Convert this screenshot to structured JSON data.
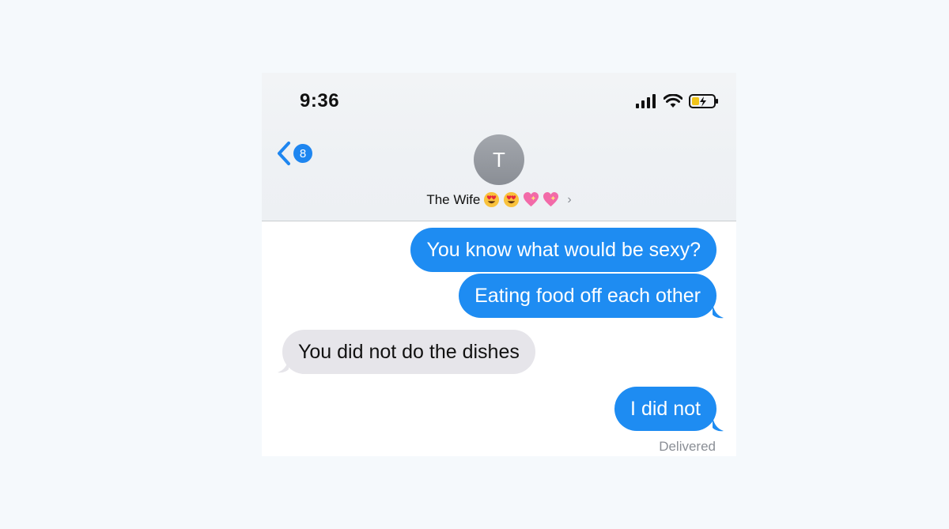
{
  "status_bar": {
    "time": "9:36"
  },
  "header": {
    "back_badge": "8",
    "avatar_initial": "T",
    "contact_name": "The Wife",
    "chevron": "›"
  },
  "messages": [
    {
      "direction": "outgoing",
      "text": "You know what would be sexy?"
    },
    {
      "direction": "outgoing",
      "text": "Eating food off each other"
    },
    {
      "direction": "incoming",
      "text": "You did not do the dishes"
    },
    {
      "direction": "outgoing",
      "text": "I did not"
    }
  ],
  "delivery_status": "Delivered",
  "colors": {
    "outgoing_bubble": "#1e8cf2",
    "incoming_bubble": "#e6e5ea",
    "accent": "#1e86f0"
  },
  "icons": [
    "signal-icon",
    "wifi-icon",
    "battery-charging-icon",
    "back-chevron-icon",
    "heart-eyes-emoji-icon",
    "sparkling-heart-emoji-icon"
  ]
}
